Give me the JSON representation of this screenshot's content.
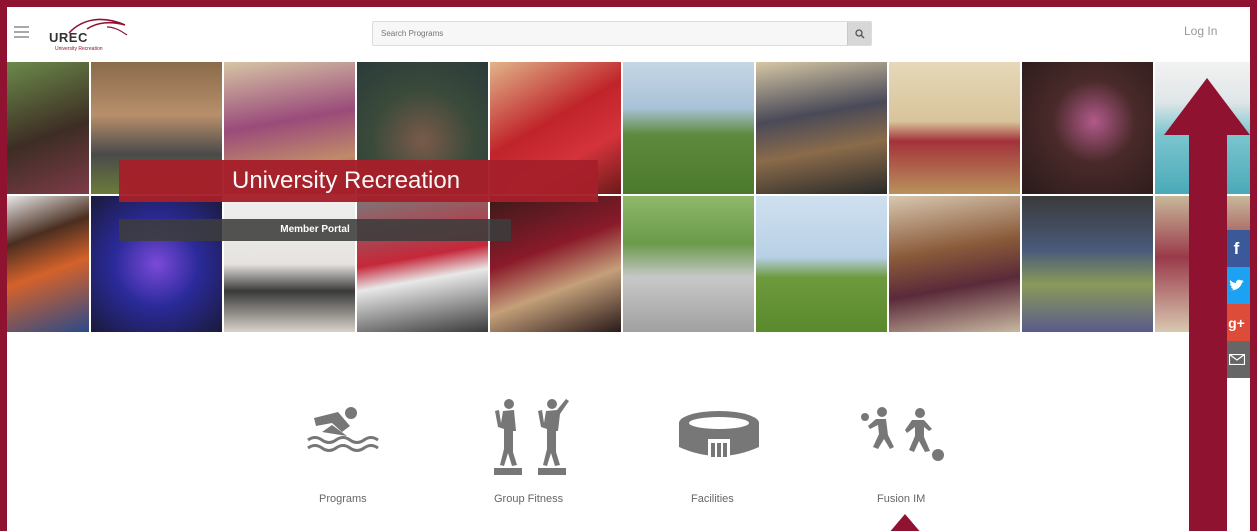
{
  "header": {
    "logo_text": "UREC",
    "logo_sub": "University Recreation",
    "search_placeholder": "Search Programs",
    "login_label": "Log In"
  },
  "banner": {
    "title": "University Recreation",
    "subtitle": "Member Portal"
  },
  "social": [
    "facebook-icon",
    "twitter-icon",
    "google-plus-icon",
    "email-icon"
  ],
  "nav": [
    {
      "label": "Programs",
      "icon": "swimmer-icon"
    },
    {
      "label": "Group Fitness",
      "icon": "step-aerobics-icon"
    },
    {
      "label": "Facilities",
      "icon": "stadium-icon"
    },
    {
      "label": "Fusion IM",
      "icon": "soccer-players-icon"
    }
  ],
  "colors": {
    "brand": "#8f1231",
    "banner_red": "#a61f2a",
    "icon_gray": "#777777"
  }
}
